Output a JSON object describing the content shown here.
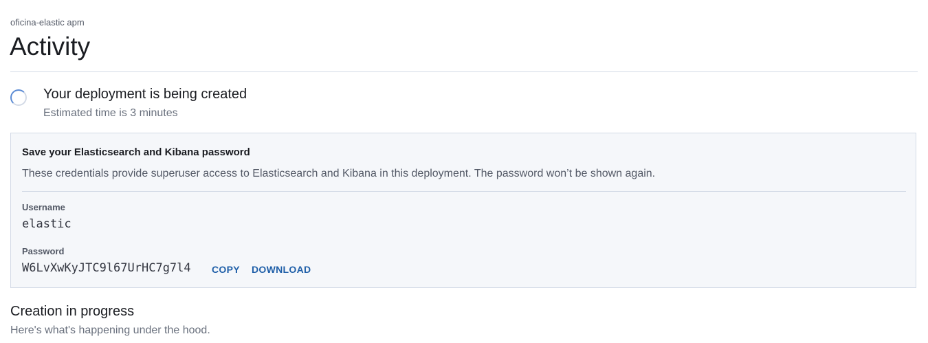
{
  "header": {
    "breadcrumb": "oficina-elastic apm",
    "title": "Activity"
  },
  "status": {
    "icon": "loading-spinner-icon",
    "heading": "Your deployment is being created",
    "subtext": "Estimated time is 3 minutes"
  },
  "credentials": {
    "title": "Save your Elasticsearch and Kibana password",
    "description": "These credentials provide superuser access to Elasticsearch and Kibana in this deployment. The password won’t be shown again.",
    "username_label": "Username",
    "username_value": "elastic",
    "password_label": "Password",
    "password_value": "W6LvXwKyJTC9l67UrHC7g7l4",
    "copy_label": "COPY",
    "download_label": "DOWNLOAD"
  },
  "progress": {
    "heading": "Creation in progress",
    "subtext": "Here's what's happening under the hood."
  },
  "colors": {
    "link": "#1f5fa8",
    "panel_bg": "#f5f7fa",
    "border": "#d3dae6",
    "spinner": "#5b8bd4"
  }
}
